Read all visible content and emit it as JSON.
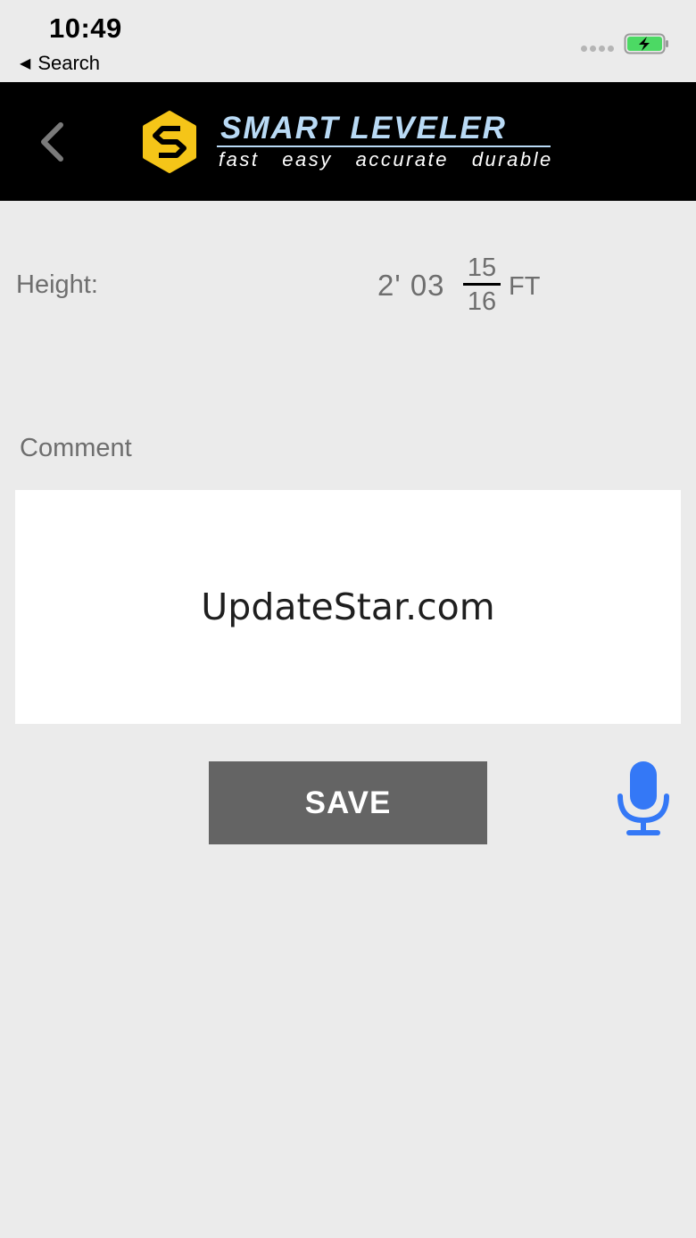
{
  "status_bar": {
    "time": "10:49",
    "back_app": "Search"
  },
  "header": {
    "brand_name": "SMART LEVELER",
    "tagline": "fast   easy   accurate   durable"
  },
  "height": {
    "label": "Height:",
    "feet_inches": "2' 03",
    "fraction_numerator": "15",
    "fraction_denominator": "16",
    "unit": "FT"
  },
  "comment": {
    "label": "Comment",
    "value": "UpdateStar.com"
  },
  "actions": {
    "save_label": "SAVE"
  },
  "colors": {
    "background": "#ebebeb",
    "header_background": "#000000",
    "logo_yellow": "#f5c518",
    "brand_blue": "#b9daf5",
    "save_button": "#646464",
    "mic_blue": "#3478f6",
    "battery_green": "#4cd964"
  },
  "icons": {
    "back": "chevron-left-icon",
    "mic": "microphone-icon",
    "battery": "battery-charging-icon",
    "logo": "smart-leveler-logo"
  }
}
